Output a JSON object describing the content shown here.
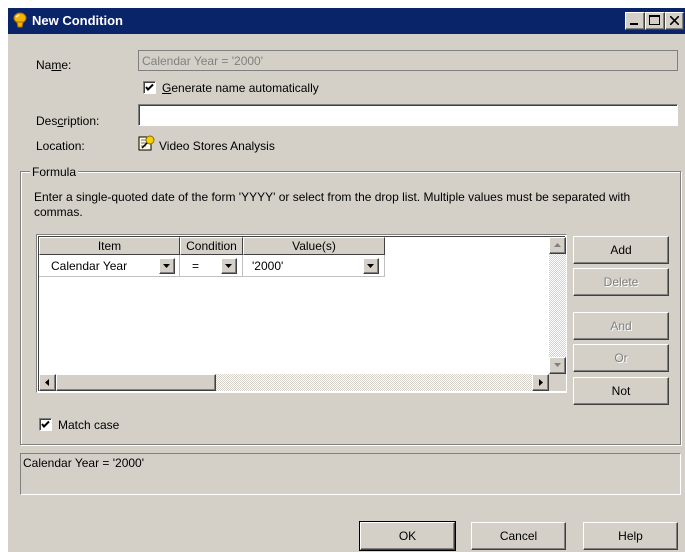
{
  "window": {
    "title": "New Condition"
  },
  "form": {
    "name_label": "Name:",
    "name_value": "Calendar Year = '2000'",
    "generate_checkbox_label": "Generate name automatically",
    "generate_checked": true,
    "description_label": "Description:",
    "description_value": "",
    "location_label": "Location:",
    "location_value": "Video Stores Analysis"
  },
  "formula": {
    "group_label": "Formula",
    "instructions": "Enter a single-quoted date of the form 'YYYY' or select from the drop list. Multiple values must be separated with commas.",
    "columns": [
      "Item",
      "Condition",
      "Value(s)"
    ],
    "rows": [
      {
        "item": "Calendar Year",
        "condition": "=",
        "value": "'2000'"
      }
    ],
    "buttons": {
      "add": "Add",
      "delete": "Delete",
      "and": "And",
      "or": "Or",
      "not": "Not"
    },
    "match_case_label": "Match case",
    "match_case_checked": true
  },
  "preview": {
    "text": "Calendar Year = '2000'"
  },
  "footer": {
    "ok": "OK",
    "cancel": "Cancel",
    "help": "Help"
  },
  "icons": {
    "window_icon": "condition-icon",
    "location_icon": "business-area-icon"
  }
}
